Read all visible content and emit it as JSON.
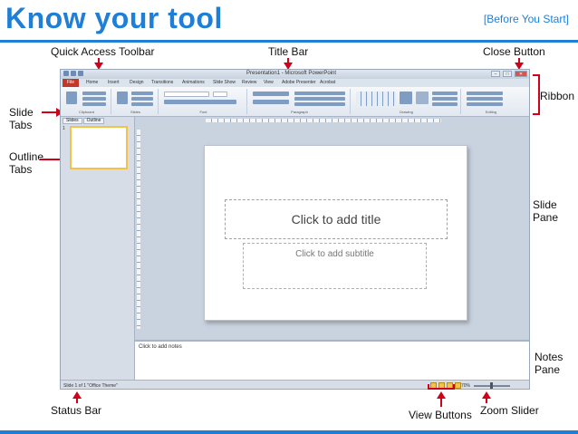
{
  "header": {
    "title": "Know your tool",
    "tag": "[Before You Start]"
  },
  "labels": {
    "quick_access_toolbar": "Quick Access Toolbar",
    "title_bar": "Title Bar",
    "close_button": "Close Button",
    "ribbon": "Ribbon",
    "slide_tabs_1": "Slide",
    "slide_tabs_2": "Tabs",
    "outline_tabs_1": "Outline",
    "outline_tabs_2": "Tabs",
    "slide_pane_1": "Slide",
    "slide_pane_2": "Pane",
    "notes_pane_1": "Notes",
    "notes_pane_2": "Pane",
    "status_bar": "Status Bar",
    "view_buttons": "View Buttons",
    "zoom_slider": "Zoom Slider"
  },
  "ppt": {
    "window_title": "Presentation1 - Microsoft PowerPoint",
    "tabs": [
      "File",
      "Home",
      "Insert",
      "Design",
      "Transitions",
      "Animations",
      "Slide Show",
      "Review",
      "View",
      "Adobe Presenter",
      "Acrobat"
    ],
    "groups": [
      "Clipboard",
      "Slides",
      "Font",
      "Paragraph",
      "Drawing",
      "Editing"
    ],
    "pane_tabs": [
      "Slides",
      "Outline"
    ],
    "thumb_number": "1",
    "slide_title_placeholder": "Click to add title",
    "slide_subtitle_placeholder": "Click to add subtitle",
    "notes_placeholder": "Click to add notes",
    "status_text": "Slide 1 of 1  \"Office Theme\"",
    "zoom_text": "70%"
  },
  "colors": {
    "accent": "#1f7fd6",
    "arrow": "#d0021b"
  }
}
